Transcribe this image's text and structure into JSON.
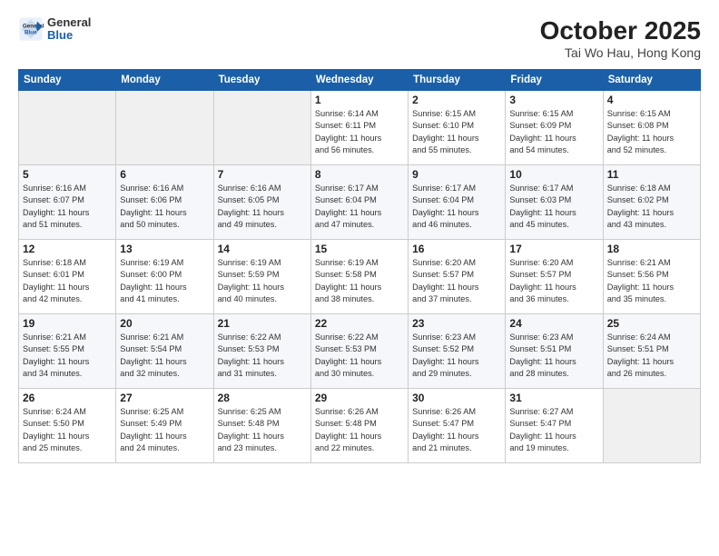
{
  "header": {
    "logo_general": "General",
    "logo_blue": "Blue",
    "month": "October 2025",
    "location": "Tai Wo Hau, Hong Kong"
  },
  "weekdays": [
    "Sunday",
    "Monday",
    "Tuesday",
    "Wednesday",
    "Thursday",
    "Friday",
    "Saturday"
  ],
  "weeks": [
    [
      {
        "day": "",
        "info": ""
      },
      {
        "day": "",
        "info": ""
      },
      {
        "day": "",
        "info": ""
      },
      {
        "day": "1",
        "info": "Sunrise: 6:14 AM\nSunset: 6:11 PM\nDaylight: 11 hours\nand 56 minutes."
      },
      {
        "day": "2",
        "info": "Sunrise: 6:15 AM\nSunset: 6:10 PM\nDaylight: 11 hours\nand 55 minutes."
      },
      {
        "day": "3",
        "info": "Sunrise: 6:15 AM\nSunset: 6:09 PM\nDaylight: 11 hours\nand 54 minutes."
      },
      {
        "day": "4",
        "info": "Sunrise: 6:15 AM\nSunset: 6:08 PM\nDaylight: 11 hours\nand 52 minutes."
      }
    ],
    [
      {
        "day": "5",
        "info": "Sunrise: 6:16 AM\nSunset: 6:07 PM\nDaylight: 11 hours\nand 51 minutes."
      },
      {
        "day": "6",
        "info": "Sunrise: 6:16 AM\nSunset: 6:06 PM\nDaylight: 11 hours\nand 50 minutes."
      },
      {
        "day": "7",
        "info": "Sunrise: 6:16 AM\nSunset: 6:05 PM\nDaylight: 11 hours\nand 49 minutes."
      },
      {
        "day": "8",
        "info": "Sunrise: 6:17 AM\nSunset: 6:04 PM\nDaylight: 11 hours\nand 47 minutes."
      },
      {
        "day": "9",
        "info": "Sunrise: 6:17 AM\nSunset: 6:04 PM\nDaylight: 11 hours\nand 46 minutes."
      },
      {
        "day": "10",
        "info": "Sunrise: 6:17 AM\nSunset: 6:03 PM\nDaylight: 11 hours\nand 45 minutes."
      },
      {
        "day": "11",
        "info": "Sunrise: 6:18 AM\nSunset: 6:02 PM\nDaylight: 11 hours\nand 43 minutes."
      }
    ],
    [
      {
        "day": "12",
        "info": "Sunrise: 6:18 AM\nSunset: 6:01 PM\nDaylight: 11 hours\nand 42 minutes."
      },
      {
        "day": "13",
        "info": "Sunrise: 6:19 AM\nSunset: 6:00 PM\nDaylight: 11 hours\nand 41 minutes."
      },
      {
        "day": "14",
        "info": "Sunrise: 6:19 AM\nSunset: 5:59 PM\nDaylight: 11 hours\nand 40 minutes."
      },
      {
        "day": "15",
        "info": "Sunrise: 6:19 AM\nSunset: 5:58 PM\nDaylight: 11 hours\nand 38 minutes."
      },
      {
        "day": "16",
        "info": "Sunrise: 6:20 AM\nSunset: 5:57 PM\nDaylight: 11 hours\nand 37 minutes."
      },
      {
        "day": "17",
        "info": "Sunrise: 6:20 AM\nSunset: 5:57 PM\nDaylight: 11 hours\nand 36 minutes."
      },
      {
        "day": "18",
        "info": "Sunrise: 6:21 AM\nSunset: 5:56 PM\nDaylight: 11 hours\nand 35 minutes."
      }
    ],
    [
      {
        "day": "19",
        "info": "Sunrise: 6:21 AM\nSunset: 5:55 PM\nDaylight: 11 hours\nand 34 minutes."
      },
      {
        "day": "20",
        "info": "Sunrise: 6:21 AM\nSunset: 5:54 PM\nDaylight: 11 hours\nand 32 minutes."
      },
      {
        "day": "21",
        "info": "Sunrise: 6:22 AM\nSunset: 5:53 PM\nDaylight: 11 hours\nand 31 minutes."
      },
      {
        "day": "22",
        "info": "Sunrise: 6:22 AM\nSunset: 5:53 PM\nDaylight: 11 hours\nand 30 minutes."
      },
      {
        "day": "23",
        "info": "Sunrise: 6:23 AM\nSunset: 5:52 PM\nDaylight: 11 hours\nand 29 minutes."
      },
      {
        "day": "24",
        "info": "Sunrise: 6:23 AM\nSunset: 5:51 PM\nDaylight: 11 hours\nand 28 minutes."
      },
      {
        "day": "25",
        "info": "Sunrise: 6:24 AM\nSunset: 5:51 PM\nDaylight: 11 hours\nand 26 minutes."
      }
    ],
    [
      {
        "day": "26",
        "info": "Sunrise: 6:24 AM\nSunset: 5:50 PM\nDaylight: 11 hours\nand 25 minutes."
      },
      {
        "day": "27",
        "info": "Sunrise: 6:25 AM\nSunset: 5:49 PM\nDaylight: 11 hours\nand 24 minutes."
      },
      {
        "day": "28",
        "info": "Sunrise: 6:25 AM\nSunset: 5:48 PM\nDaylight: 11 hours\nand 23 minutes."
      },
      {
        "day": "29",
        "info": "Sunrise: 6:26 AM\nSunset: 5:48 PM\nDaylight: 11 hours\nand 22 minutes."
      },
      {
        "day": "30",
        "info": "Sunrise: 6:26 AM\nSunset: 5:47 PM\nDaylight: 11 hours\nand 21 minutes."
      },
      {
        "day": "31",
        "info": "Sunrise: 6:27 AM\nSunset: 5:47 PM\nDaylight: 11 hours\nand 19 minutes."
      },
      {
        "day": "",
        "info": ""
      }
    ]
  ]
}
